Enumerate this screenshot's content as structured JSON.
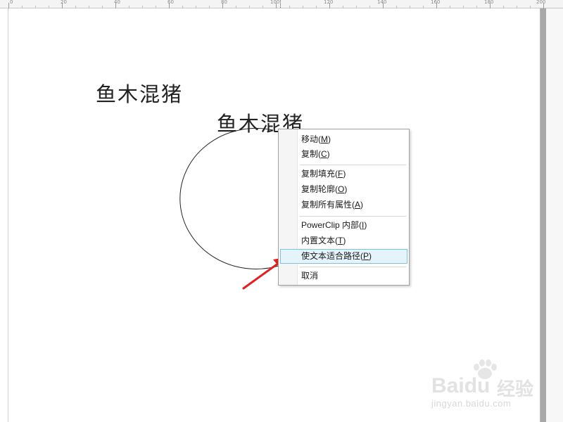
{
  "ruler": {
    "labels": [
      "0",
      "20",
      "40",
      "60",
      "80",
      "100",
      "120",
      "140",
      "160",
      "180",
      "200"
    ]
  },
  "canvas": {
    "text_objects": [
      {
        "text": "鱼木混猪"
      },
      {
        "text": "鱼木混猪"
      }
    ]
  },
  "context_menu": {
    "items": [
      {
        "label": "移动(M)",
        "underline_key": "M"
      },
      {
        "label": "复制(C)",
        "underline_key": "C"
      },
      {
        "label": "复制填充(F)",
        "underline_key": "F"
      },
      {
        "label": "复制轮廓(O)",
        "underline_key": "O"
      },
      {
        "label": "复制所有属性(A)",
        "underline_key": "A"
      },
      {
        "label": "PowerClip 内部(I)",
        "underline_key": "I"
      },
      {
        "label": "内置文本(T)",
        "underline_key": "T"
      },
      {
        "label": "使文本适合路径(P)",
        "underline_key": "P",
        "highlighted": true
      },
      {
        "label": "取消"
      }
    ]
  },
  "annotation": {
    "arrow_color": "#e02020",
    "icon": "red-arrow-icon"
  },
  "watermark": {
    "brand": "Bai",
    "brand_suffix": "du",
    "cn": "经验",
    "url": "jingyan.baidu.com"
  },
  "colors": {
    "menu_highlight": "#e5f3fb",
    "menu_highlight_border": "#7ec2e8"
  }
}
